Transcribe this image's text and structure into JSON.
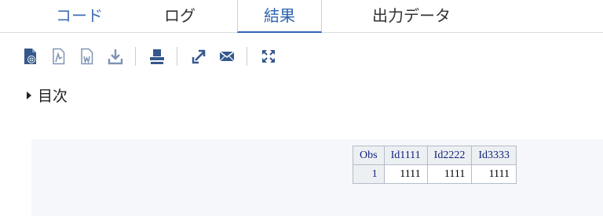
{
  "tabs": {
    "code": "コード",
    "log": "ログ",
    "results": "結果",
    "output_data": "出力データ"
  },
  "toolbar": {
    "icons": [
      "html-report-icon",
      "pdf-icon",
      "word-icon",
      "download-icon",
      "print-icon",
      "open-new-window-icon",
      "email-icon",
      "maximize-icon"
    ]
  },
  "toc": {
    "label": "目次"
  },
  "table": {
    "headers": [
      "Obs",
      "Id1111",
      "Id2222",
      "Id3333"
    ],
    "rows": [
      {
        "obs": "1",
        "id1111": "1111",
        "id2222": "1111",
        "id3333": "1111"
      }
    ]
  },
  "colors": {
    "accent": "#2d64b0",
    "icon": "#35588c",
    "header_text": "#112277"
  }
}
